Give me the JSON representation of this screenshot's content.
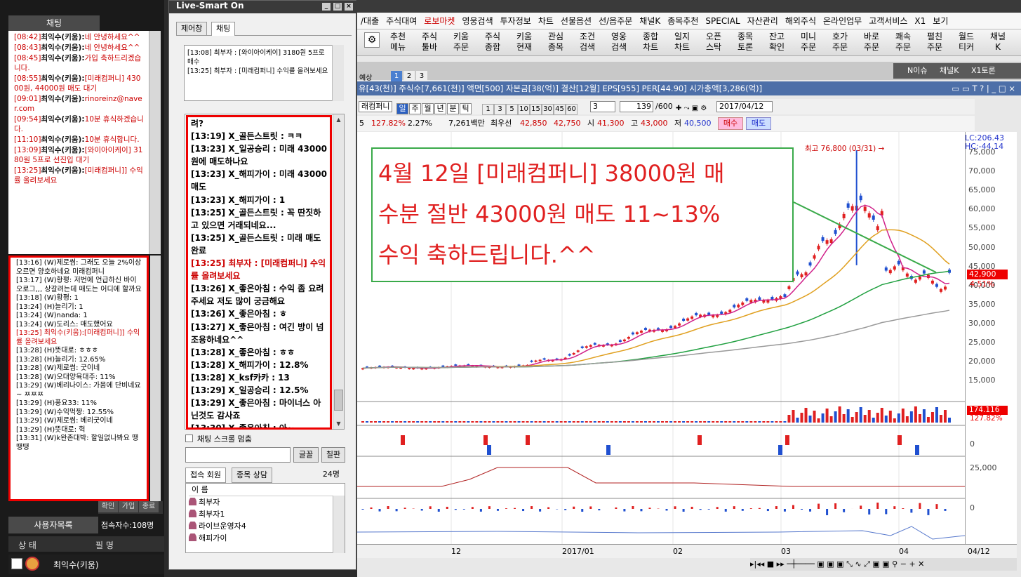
{
  "left_panel": {
    "chat_tab": "채팅",
    "messages": [
      {
        "time": "[08:42]",
        "user": "최익수(키움):",
        "text": "네 안녕하세요^^"
      },
      {
        "time": "[08:43]",
        "user": "최익수(키움):",
        "text": "네 안녕하세요^^"
      },
      {
        "time": "[08:45]",
        "user": "최익수(키움):",
        "text": "가입 축하드리겠습니다."
      },
      {
        "time": "[08:55]",
        "user": "최익수(키움):",
        "text": "[미래컴퍼니] 43000원, 44000원 매도 대기"
      },
      {
        "time": "[09:01]",
        "user": "최익수(키움):",
        "text": "rinoreinz@naver.com"
      },
      {
        "time": "[09:54]",
        "user": "최익수(키움):",
        "text": "10분 휴식하겠습니다."
      },
      {
        "time": "[11:10]",
        "user": "최익수(키움):",
        "text": "10분 휴식합니다."
      },
      {
        "time": "[13:09]",
        "user": "최익수(키움):",
        "text": "[와이아이케이] 3180원 5프로 선진입 대기"
      },
      {
        "time": "[13:25]",
        "user": "최익수(키움):",
        "text": "[미래컴퍼니]] 수익률 올려보세요"
      }
    ],
    "messages2": [
      {
        "text": "[13:16] (W)제로썸: 그래도 오늘 2%이상 오르면 양호하네요 미래컴퍼니",
        "red": false
      },
      {
        "text": "[13:17] (W)황평: 저번에 언급하신 바이오로그,,, 상갈려는데 매도는 어디에 할까요",
        "red": false
      },
      {
        "text": "[13:18] (W)황평: 1",
        "red": false
      },
      {
        "text": "[13:24] (H)늘리기: 1",
        "red": false
      },
      {
        "text": "[13:24] (W)nanda: 1",
        "red": false
      },
      {
        "text": "[13:24] (W)도리스: 매도했어요",
        "red": false
      },
      {
        "text": "[13:25] 최익수(키움):[미래컴퍼니]] 수익률 올려보세요",
        "red": true
      },
      {
        "text": "[13:28] (H)뜻대로: ㅎㅎㅎ",
        "red": false
      },
      {
        "text": "[13:28] (H)늘리기: 12.65%",
        "red": false
      },
      {
        "text": "[13:28] (W)제로썸: 굿이네",
        "red": false
      },
      {
        "text": "[13:28] (W)오대양육대주: 11%",
        "red": false
      },
      {
        "text": "[13:29] (W)베리나이스: 가뭄에 단비네요~ ㅉㅉㅉ",
        "red": false
      },
      {
        "text": "[13:29] (H)풍요33: 11%",
        "red": false
      },
      {
        "text": "[13:29] (W)수익먹짱: 12.55%",
        "red": false
      },
      {
        "text": "[13:29] (W)제로썸: 베리굿이네",
        "red": false
      },
      {
        "text": "[13:29] (H)뜻대로: 헉",
        "red": false
      },
      {
        "text": "[13:31] (W)k완존대박: 할일없나봐요 땡땡땡",
        "red": false
      }
    ],
    "buttons": [
      "확인",
      "가입",
      "종료"
    ],
    "user_list_tab": "사용자목록",
    "user_count": "접속자수:108명",
    "col_status": "상 태",
    "col_nick": "필 명",
    "user_row": "최익수(키움)"
  },
  "mid_panel": {
    "title": "Live-Smart On",
    "tabs": [
      "제어창",
      "채팅"
    ],
    "notice": [
      "[13:08] 최부자 : [와이아이케이] 3180원 5프로 매수",
      "[13:25] 최부자 : [미래컴퍼니] 수익률 올려보세요"
    ],
    "chat": [
      {
        "text": "려?",
        "red": false
      },
      {
        "text": "[13:19] X_골든스트릿 : ㅋㅋ",
        "red": false
      },
      {
        "text": "[13:23] X_일공승리 : 미래 43000원에 매도하나요",
        "red": false
      },
      {
        "text": "[13:23] X_해피가이 : 미래 43000 매도",
        "red": false
      },
      {
        "text": "[13:23] X_해피가이 : 1",
        "red": false
      },
      {
        "text": "[13:25] X_골든스트릿 : 꼭 딴짓하고 있으면 거래되네요...",
        "red": false
      },
      {
        "text": "[13:25] X_골든스트릿 : 미래 매도 완료",
        "red": false
      },
      {
        "text": "[13:25] 최부자 : [미래컴퍼니] 수익률 올려보세요",
        "red": true
      },
      {
        "text": "[13:26] X_좋은아침 : 수익 좀 요려주세요 저도 많이 궁금해요",
        "red": false
      },
      {
        "text": "[13:26] X_좋은아침 : ㅎ",
        "red": false
      },
      {
        "text": "[13:27] X_좋은아침 : 여긴 방이 넘 조용하네요^^",
        "red": false
      },
      {
        "text": "[13:28] X_좋은아침 : ㅎㅎ",
        "red": false
      },
      {
        "text": "[13:28] X_해피가이 : 12.8%",
        "red": false
      },
      {
        "text": "[13:28] X_ksf카카 : 13",
        "red": false
      },
      {
        "text": "[13:29] X_일공승리 : 12.5%",
        "red": false
      },
      {
        "text": "[13:29] X_좋은아침 : 마이너스 아닌것도 감사죠",
        "red": false
      },
      {
        "text": "[13:30] X_좋은아침 : 아~",
        "red": false
      }
    ],
    "scroll_stop": "채팅 스크롤 멈춤",
    "font_btn": "글꼴",
    "clear_btn": "칠판",
    "tabs2": [
      "접속 회원",
      "종목 상담"
    ],
    "member_count": "24명",
    "list_header": "이 름",
    "members": [
      "최부자",
      "최부자1",
      "라이브운영자4",
      "해피가이"
    ]
  },
  "right_panel": {
    "menu": [
      "/대출",
      "주식대여",
      "로보마켓",
      "영웅검색",
      "투자정보",
      "차트",
      "선물옵션",
      "선/옵주문",
      "채널K",
      "종목추천",
      "SPECIAL",
      "자산관리",
      "해외주식",
      "온라인업무",
      "고객서비스",
      "X1",
      "보기"
    ],
    "toolbar": [
      [
        "추천",
        "메뉴"
      ],
      [
        "주식",
        "툴바"
      ],
      [
        "키움",
        "주문"
      ],
      [
        "주식",
        "종합"
      ],
      [
        "키움",
        "현재"
      ],
      [
        "관심",
        "종목"
      ],
      [
        "조건",
        "검색"
      ],
      [
        "영웅",
        "검색"
      ],
      [
        "종합",
        "차트"
      ],
      [
        "일지",
        "차트"
      ],
      [
        "오픈",
        "스탁"
      ],
      [
        "종목",
        "토론"
      ],
      [
        "잔고",
        "확인"
      ],
      [
        "미니",
        "주문"
      ],
      [
        "호가",
        "주문"
      ],
      [
        "바로",
        "주문"
      ],
      [
        "쾌속",
        "주문"
      ],
      [
        "펼친",
        "주문"
      ],
      [
        "월드",
        "티커"
      ],
      [
        "채널",
        "K"
      ]
    ],
    "right_tabs": [
      "N이슈",
      "채널K",
      "X1토론"
    ],
    "tabset_label": "예상",
    "tab_numbers": [
      "1",
      "2",
      "3"
    ],
    "info": "유[43(천)] 주식수[7,661(천)] 액면[500] 자본금[38(억)] 결산[12월] EPS[955] PER[44.90] 시가총액[3,286(억)]",
    "stock_name": "래컴퍼니",
    "periods": [
      "일",
      "주",
      "월",
      "년",
      "분",
      "틱"
    ],
    "minute_opts": [
      "1",
      "3",
      "5",
      "10",
      "15",
      "30",
      "45",
      "60"
    ],
    "cnt_val": "3",
    "page": "139",
    "total": "/600",
    "date": "2017/04/12",
    "price_line": {
      "a": "5",
      "b": "127.82%",
      "c": "2.27%",
      "d": "7,261백만",
      "e": "최우선",
      "f": "42,850",
      "g": "42,750",
      "h": "시",
      "i": "41,300",
      "j": "고",
      "k": "43,000",
      "l": "저",
      "m": "40,500"
    },
    "buy_btn": "매수",
    "sell_btn": "매도",
    "max_label": "최고 76,800 (03/31) →",
    "lc": "LC:206.43",
    "hc": "HC:-44.14",
    "yticks": [
      "75,000",
      "70,000",
      "65,000",
      "60,000",
      "55,000",
      "50,000",
      "45,000",
      "40,000",
      "35,000",
      "30,000",
      "25,000",
      "20,000",
      "15,000"
    ],
    "price_tag": "42,900",
    "pct_tag": "4.51%",
    "vol_tag": "174.116",
    "vol_pct": "127.82%",
    "y2": "0",
    "y3": "25,000",
    "y4": "0",
    "x_labels": [
      "12",
      "2017/01",
      "02",
      "03",
      "04",
      "04/12"
    ],
    "overlay": [
      "4월 12일 [미래컴퍼니] 38000원 매",
      "수분 절반 43000원 매도 11~13%",
      "수익 축하드립니다.^^"
    ]
  },
  "chart_data": {
    "type": "candlestick",
    "title": "",
    "x_labels": [
      "12",
      "2017/01",
      "02",
      "03",
      "04"
    ],
    "y_range": [
      10000,
      78000
    ],
    "max_price": 76800,
    "last_price": 42900,
    "change_pct": 4.51,
    "colors": {
      "up": "#e02020",
      "down": "#2050d0",
      "ma5": "#d0208a",
      "ma20": "#e0a020",
      "ma60": "#20a040",
      "ma120": "#999999"
    }
  }
}
